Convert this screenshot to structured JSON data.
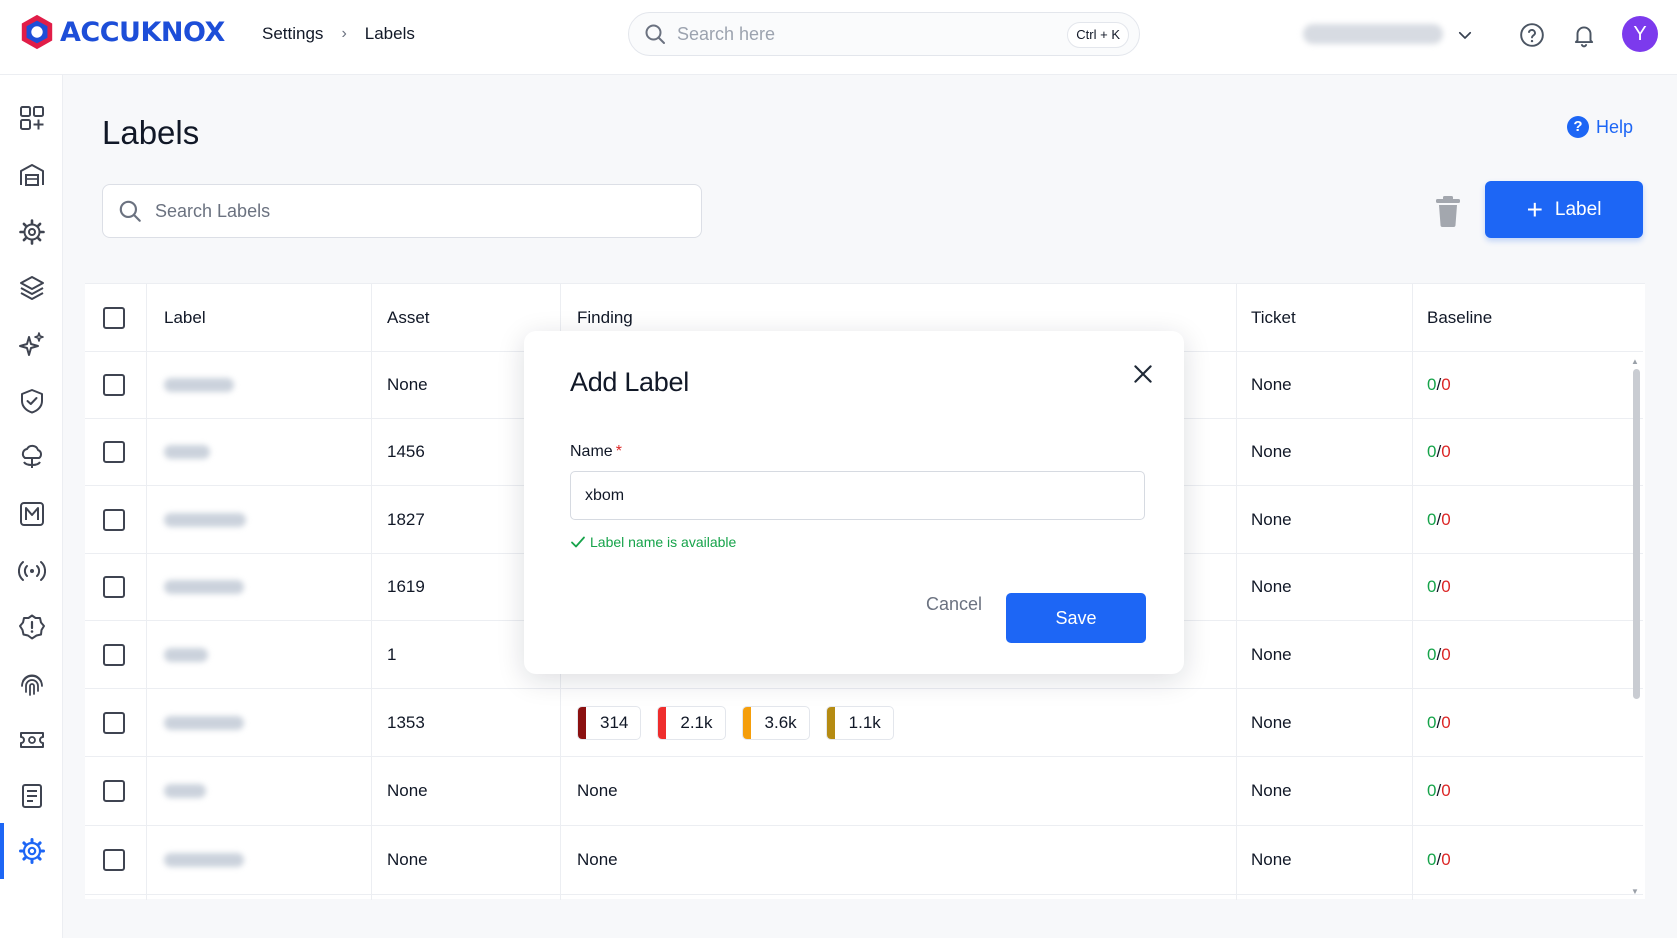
{
  "app": {
    "brand": "ACCUKNOX",
    "breadcrumb": [
      "Settings",
      "Labels"
    ],
    "search_placeholder": "Search here",
    "search_shortcut": "Ctrl + K",
    "avatar_initial": "Y"
  },
  "colors": {
    "accent": "#1d66f5",
    "ok_green": "#16a34a",
    "error_red": "#dc2626",
    "avatar": "#7c3aed"
  },
  "sidebar": {
    "items": [
      {
        "icon": "dashboard-add-icon",
        "active": false
      },
      {
        "icon": "inventory-icon",
        "active": false
      },
      {
        "icon": "gear-cog-icon",
        "active": false
      },
      {
        "icon": "layers-icon",
        "active": false
      },
      {
        "icon": "sparkle-ai-icon",
        "active": false
      },
      {
        "icon": "shield-check-icon",
        "active": false
      },
      {
        "icon": "cloud-runtime-icon",
        "active": false
      },
      {
        "icon": "m-box-icon",
        "active": false
      },
      {
        "icon": "broadcast-icon",
        "active": false
      },
      {
        "icon": "alert-badge-icon",
        "active": false
      },
      {
        "icon": "fingerprint-icon",
        "active": false
      },
      {
        "icon": "ticket-icon",
        "active": false
      },
      {
        "icon": "report-list-icon",
        "active": false
      },
      {
        "icon": "settings-icon",
        "active": true
      }
    ]
  },
  "page": {
    "title": "Labels",
    "help_label": "Help",
    "search_placeholder": "Search Labels",
    "add_button_label": "Label"
  },
  "table": {
    "columns": [
      "Label",
      "Asset",
      "Finding",
      "Ticket",
      "Baseline"
    ],
    "rows": [
      {
        "asset": "None",
        "finding": "",
        "ticket": "None",
        "baseline_ok": "0",
        "baseline_total": "0"
      },
      {
        "asset": "1456",
        "finding": "",
        "ticket": "None",
        "baseline_ok": "0",
        "baseline_total": "0"
      },
      {
        "asset": "1827",
        "finding": "",
        "ticket": "None",
        "baseline_ok": "0",
        "baseline_total": "0"
      },
      {
        "asset": "1619",
        "finding": "",
        "ticket": "None",
        "baseline_ok": "0",
        "baseline_total": "0"
      },
      {
        "asset": "1",
        "finding": "",
        "ticket": "None",
        "baseline_ok": "0",
        "baseline_total": "0"
      },
      {
        "asset": "1353",
        "finding": "",
        "ticket": "None",
        "baseline_ok": "0",
        "baseline_total": "0",
        "severities": [
          {
            "value": "314",
            "color": "#8b1010"
          },
          {
            "value": "2.1k",
            "color": "#ef2d2d"
          },
          {
            "value": "3.6k",
            "color": "#f59e0b"
          },
          {
            "value": "1.1k",
            "color": "#b58b12"
          }
        ]
      },
      {
        "asset": "None",
        "finding": "None",
        "ticket": "None",
        "baseline_ok": "0",
        "baseline_total": "0"
      },
      {
        "asset": "None",
        "finding": "None",
        "ticket": "None",
        "baseline_ok": "0",
        "baseline_total": "0"
      }
    ]
  },
  "modal": {
    "title": "Add Label",
    "name_label": "Name",
    "required_mark": "*",
    "name_value": "xbom",
    "availability_message": "Label name is available",
    "cancel_label": "Cancel",
    "save_label": "Save"
  }
}
